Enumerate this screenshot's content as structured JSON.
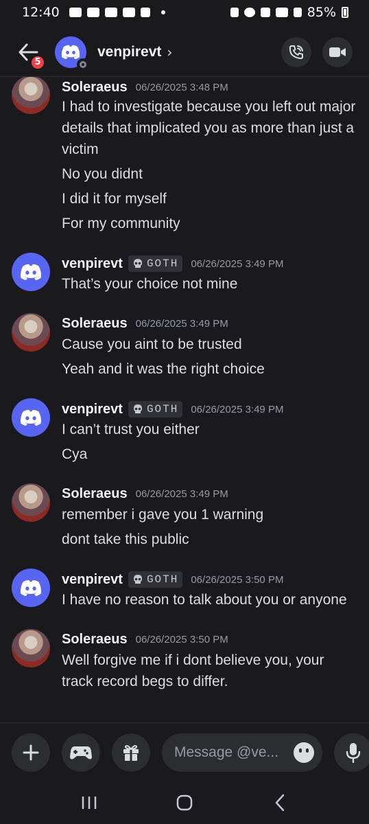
{
  "status_bar": {
    "time": "12:40",
    "battery": "85%"
  },
  "header": {
    "back_badge": "5",
    "channel_name": "venpirevt",
    "chevron": "›"
  },
  "messages": [
    {
      "author": "Soleraeus",
      "tag": "",
      "timestamp": "06/26/2025 3:48 PM",
      "lines": [
        "I had to investigate because you left out major details that implicated you as more than just a victim",
        "No you didnt",
        "I did it for myself",
        "For my community"
      ]
    },
    {
      "author": "venpirevt",
      "tag": "GOTH",
      "timestamp": "06/26/2025 3:49 PM",
      "lines": [
        "That’s your choice not mine"
      ]
    },
    {
      "author": "Soleraeus",
      "tag": "",
      "timestamp": "06/26/2025 3:49 PM",
      "lines": [
        "Cause you aint to be trusted",
        "Yeah and it was the right choice"
      ]
    },
    {
      "author": "venpirevt",
      "tag": "GOTH",
      "timestamp": "06/26/2025 3:49 PM",
      "lines": [
        "I can’t trust you either",
        "Cya"
      ]
    },
    {
      "author": "Soleraeus",
      "tag": "",
      "timestamp": "06/26/2025 3:49 PM",
      "lines": [
        "remember i gave you 1 warning",
        "dont take this public"
      ]
    },
    {
      "author": "venpirevt",
      "tag": "GOTH",
      "timestamp": "06/26/2025 3:50 PM",
      "lines": [
        "I have no reason to talk about you or anyone"
      ]
    },
    {
      "author": "Soleraeus",
      "tag": "",
      "timestamp": "06/26/2025 3:50 PM",
      "lines": [
        "Well forgive me if i dont believe you, your track record begs to differ."
      ]
    }
  ],
  "composer": {
    "placeholder": "Message @ve..."
  },
  "colors": {
    "background": "#1a1a1e",
    "blurple": "#5865f2",
    "badge_red": "#f23f43",
    "timestamp": "#949ba4"
  },
  "icons": [
    "back-arrow-icon",
    "discord-logo-icon",
    "phone-call-icon",
    "video-camera-icon",
    "plus-icon",
    "gamepad-icon",
    "gift-icon",
    "emoji-icon",
    "microphone-icon",
    "skull-icon",
    "recents-icon",
    "home-icon",
    "back-nav-icon"
  ]
}
